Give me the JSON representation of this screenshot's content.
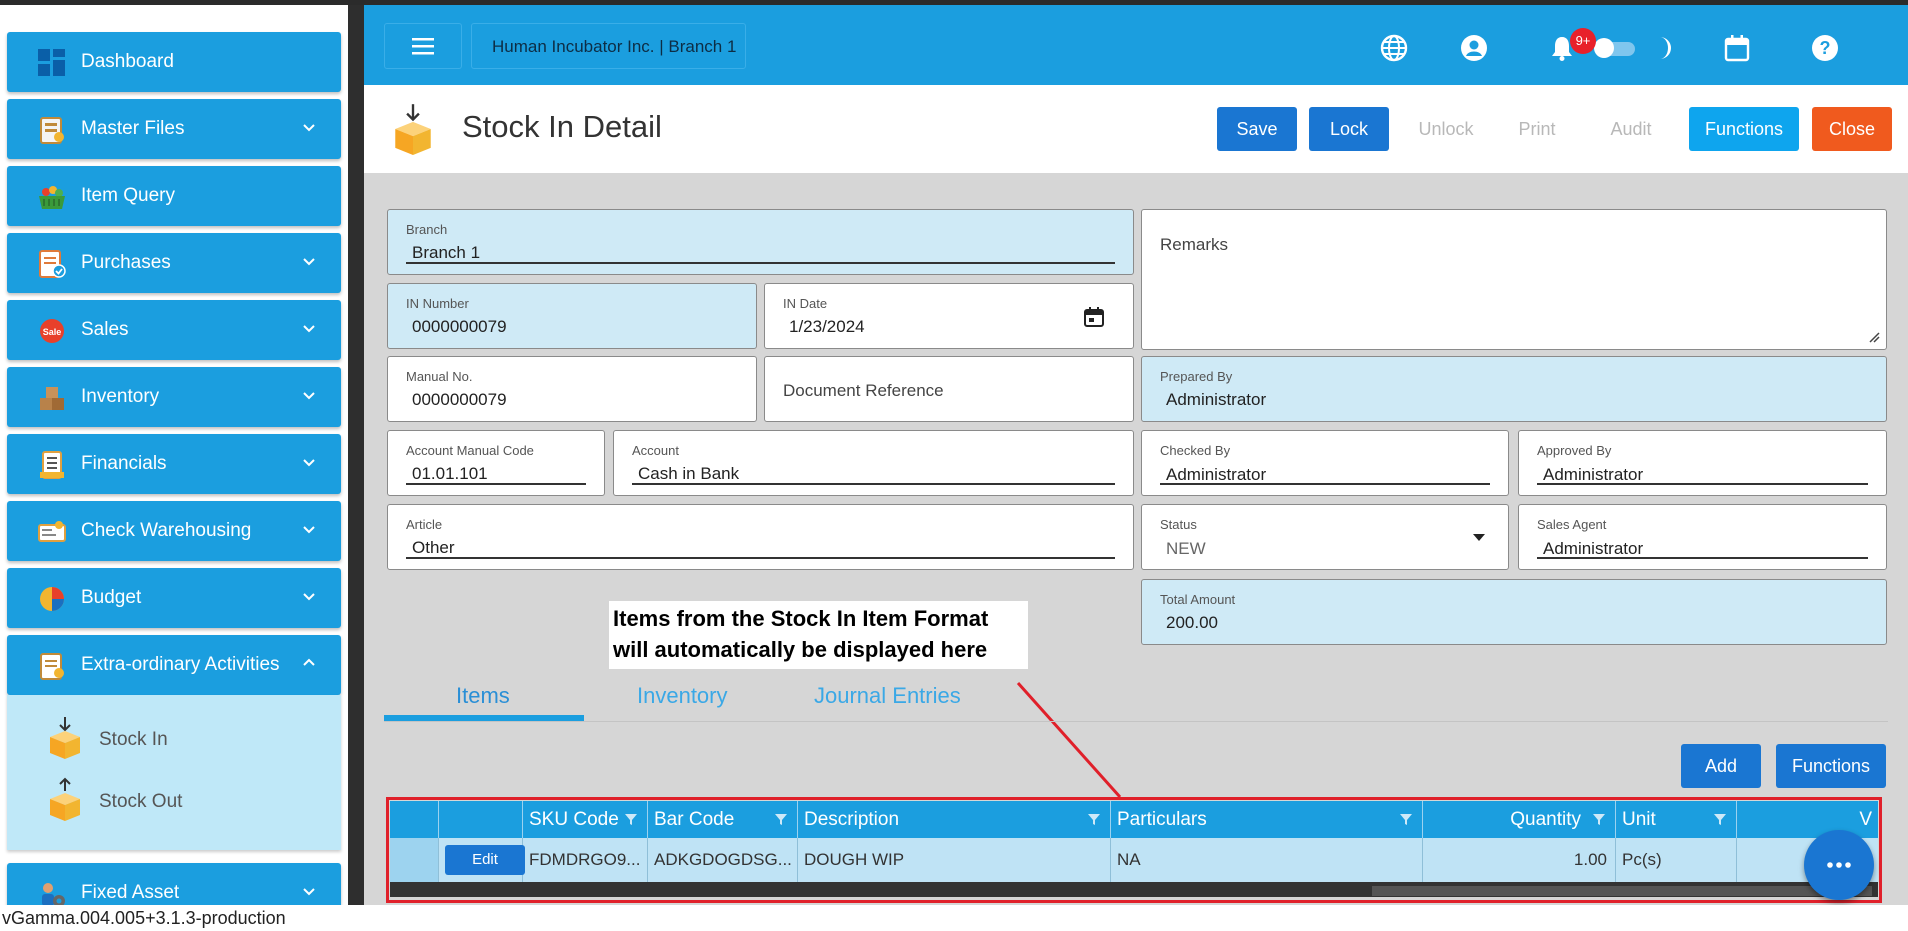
{
  "sidebar": {
    "items": [
      {
        "label": "Dashboard",
        "icon": "dashboard-icon",
        "has_chevron": false
      },
      {
        "label": "Master Files",
        "icon": "master-files-icon",
        "has_chevron": true
      },
      {
        "label": "Item Query",
        "icon": "basket-icon",
        "has_chevron": false
      },
      {
        "label": "Purchases",
        "icon": "purchases-icon",
        "has_chevron": true
      },
      {
        "label": "Sales",
        "icon": "sale-tag-icon",
        "has_chevron": true
      },
      {
        "label": "Inventory",
        "icon": "boxes-icon",
        "has_chevron": true
      },
      {
        "label": "Financials",
        "icon": "ledger-icon",
        "has_chevron": true
      },
      {
        "label": "Check Warehousing",
        "icon": "check-icon",
        "has_chevron": true
      },
      {
        "label": "Budget",
        "icon": "pie-chart-icon",
        "has_chevron": true
      },
      {
        "label": "Extra-ordinary Activities",
        "icon": "activities-icon",
        "has_chevron": true,
        "expanded": true
      },
      {
        "label": "Fixed Asset",
        "icon": "asset-gear-icon",
        "has_chevron": true
      }
    ],
    "sub_items": [
      {
        "label": "Stock In",
        "icon": "stock-in-box-icon"
      },
      {
        "label": "Stock Out",
        "icon": "stock-out-box-icon"
      }
    ]
  },
  "header": {
    "company": "Human Incubator Inc. | Branch 1",
    "notification_badge": "9+"
  },
  "page": {
    "title": "Stock In Detail",
    "buttons": {
      "save": "Save",
      "lock": "Lock",
      "unlock": "Unlock",
      "print": "Print",
      "audit": "Audit",
      "functions": "Functions",
      "close": "Close"
    }
  },
  "form": {
    "branch": {
      "label": "Branch",
      "value": "Branch 1"
    },
    "in_number": {
      "label": "IN Number",
      "value": "0000000079"
    },
    "in_date": {
      "label": "IN Date",
      "value": "1/23/2024"
    },
    "manual_no": {
      "label": "Manual No.",
      "value": "0000000079"
    },
    "document_reference": {
      "placeholder": "Document Reference"
    },
    "account_manual_code": {
      "label": "Account Manual Code",
      "value": "01.01.101"
    },
    "account": {
      "label": "Account",
      "value": "Cash in Bank"
    },
    "article": {
      "label": "Article",
      "value": "Other"
    },
    "remarks": {
      "placeholder": "Remarks"
    },
    "prepared_by": {
      "label": "Prepared By",
      "value": "Administrator"
    },
    "checked_by": {
      "label": "Checked By",
      "value": "Administrator"
    },
    "approved_by": {
      "label": "Approved By",
      "value": "Administrator"
    },
    "status": {
      "label": "Status",
      "value": "NEW"
    },
    "sales_agent": {
      "label": "Sales Agent",
      "value": "Administrator"
    },
    "total_amount": {
      "label": "Total Amount",
      "value": "200.00"
    }
  },
  "annotation": {
    "line1": "Items from the Stock In Item Format",
    "line2": "will automatically be displayed here"
  },
  "tabs": [
    {
      "label": "Items",
      "active": true
    },
    {
      "label": "Inventory",
      "active": false
    },
    {
      "label": "Journal Entries",
      "active": false
    }
  ],
  "grid_toolbar": {
    "add": "Add",
    "functions": "Functions"
  },
  "grid": {
    "columns": [
      "SKU Code",
      "Bar Code",
      "Description",
      "Particulars",
      "Quantity",
      "Unit",
      "V"
    ],
    "rows": [
      {
        "edit": "Edit",
        "sku": "FDMDRGO9...",
        "barcode": "ADKGDOGDSG...",
        "description": "DOUGH WIP",
        "particulars": "NA",
        "quantity": "1.00",
        "unit": "Pc(s)"
      }
    ]
  },
  "footer": {
    "version": "vGamma.004.005+3.1.3-production"
  },
  "colors": {
    "primary": "#1b9edf",
    "button_blue": "#1a76d2",
    "functions_cyan": "#0ea5ee",
    "close_orange": "#f05a1e",
    "badge_red": "#e8202a",
    "annotation_red": "#e0202a"
  }
}
